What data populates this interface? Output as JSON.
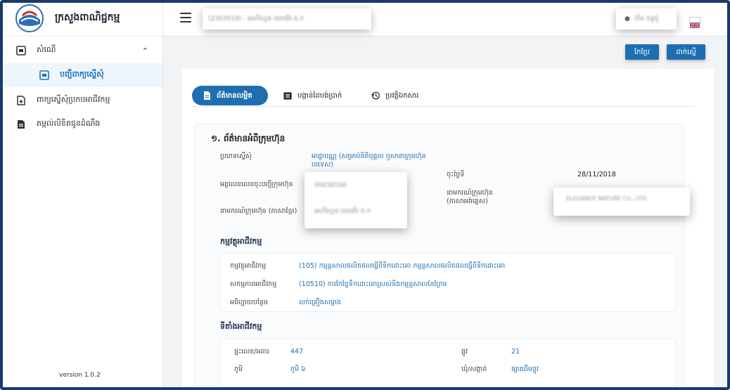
{
  "app": {
    "title": "ក្រសួងពាណិជ្ជកម្ម",
    "version": "version 1.0.2"
  },
  "sidebar": {
    "items": [
      {
        "label": "សំណើ",
        "icon": "inbox-icon"
      },
      {
        "label": "បញ្ជីពាក្យស្នើសុំ",
        "icon": "inbox-icon"
      },
      {
        "label": "ពាក្យស្នើសុំប្រកបអាជីវកម្ម",
        "icon": "file-plus-icon"
      },
      {
        "label": "តម្កល់លិខិតជូនដំណឹង",
        "icon": "document-icon"
      }
    ]
  },
  "header": {
    "company": "(2303519) - អេលីហ្គេន នេតឆើរ ឯ.ក",
    "user": "លីម ចន្ធារ៉ូ",
    "lang_flag": "uk-flag"
  },
  "actions": {
    "edit_label": "កែប្រែ",
    "submit_label": "ដាក់ស្នើ"
  },
  "tabs": [
    {
      "label": "ព័ត៌មានលម្អិត",
      "icon": "document-icon"
    },
    {
      "label": "បង្កាន់ដៃបង់ប្រាក់",
      "icon": "receipt-icon"
    },
    {
      "label": "ប្រវត្តិឯកសារ",
      "icon": "history-icon"
    }
  ],
  "details": {
    "section_title": "១. ព័ត៌មានអំពីក្រុមហ៊ុន",
    "request_type_label": "ប្រភេទស្នើសុំ",
    "request_type_value": "អាជ្ញាបណ្ណ (សម្រាប់និតិបុគ្គល ឬសាខាក្រុមហ៊ុនបរទេស)",
    "reg_no_label": "អត្តលេខលេខចុះបញ្ជីក្រុមហ៊ុន",
    "reg_no_value": "00038166",
    "name_kh_label": "នាមករណ៍ក្រុមហ៊ុន (ភាសាខ្មែរ)",
    "name_kh_value": "អេលីហ្គេន នេតឆើរ ឯ.ក",
    "date_label": "ចុះថ្ងៃទី",
    "date_value": "28/11/2018",
    "name_en_label": "នាមករណ៍ក្រុមហ៊ុន (ភាសាអង់គ្លេស)",
    "name_en_value": "ELEGANCE NATURE CO., LTD.",
    "activity_title": "កម្មវត្ថុអាជីវកម្ម",
    "activity_label": "កម្មវត្ថុអាជីវកម្ម",
    "activity_value": "(105) កម្មន្តសាលផលិតផលធ្វើពីទឹកដោះគោ កម្មន្តសាលផលិតផលធ្វើពីទឹកដោះគោ",
    "sector_label": "សកម្មភាពអាជីវកម្ម",
    "sector_value": "(10510) ការកែច្នៃទឹកដោះគោស្រស់និងកម្មន្តសាលនៃក្រែម",
    "desc_label": "អធិប្បាយបន្ថែម",
    "desc_value": "លក់គ្រឿងសម្អាង",
    "location_title": "ទីតាំងអាជីវកម្ម",
    "house_label": "ផ្ទះលេខ/អគារ",
    "house_value": "447",
    "street_label": "ផ្លូវ",
    "street_value": "21",
    "village_label": "ភូមិ",
    "village_value": "ភូមិ ៦",
    "commune_label": "ឃុំ/សង្កាត់",
    "commune_value": "ផ្សារដើមថ្កូវ"
  },
  "colors": {
    "primary": "#1d6fb1",
    "frame": "#1a3a6b"
  }
}
